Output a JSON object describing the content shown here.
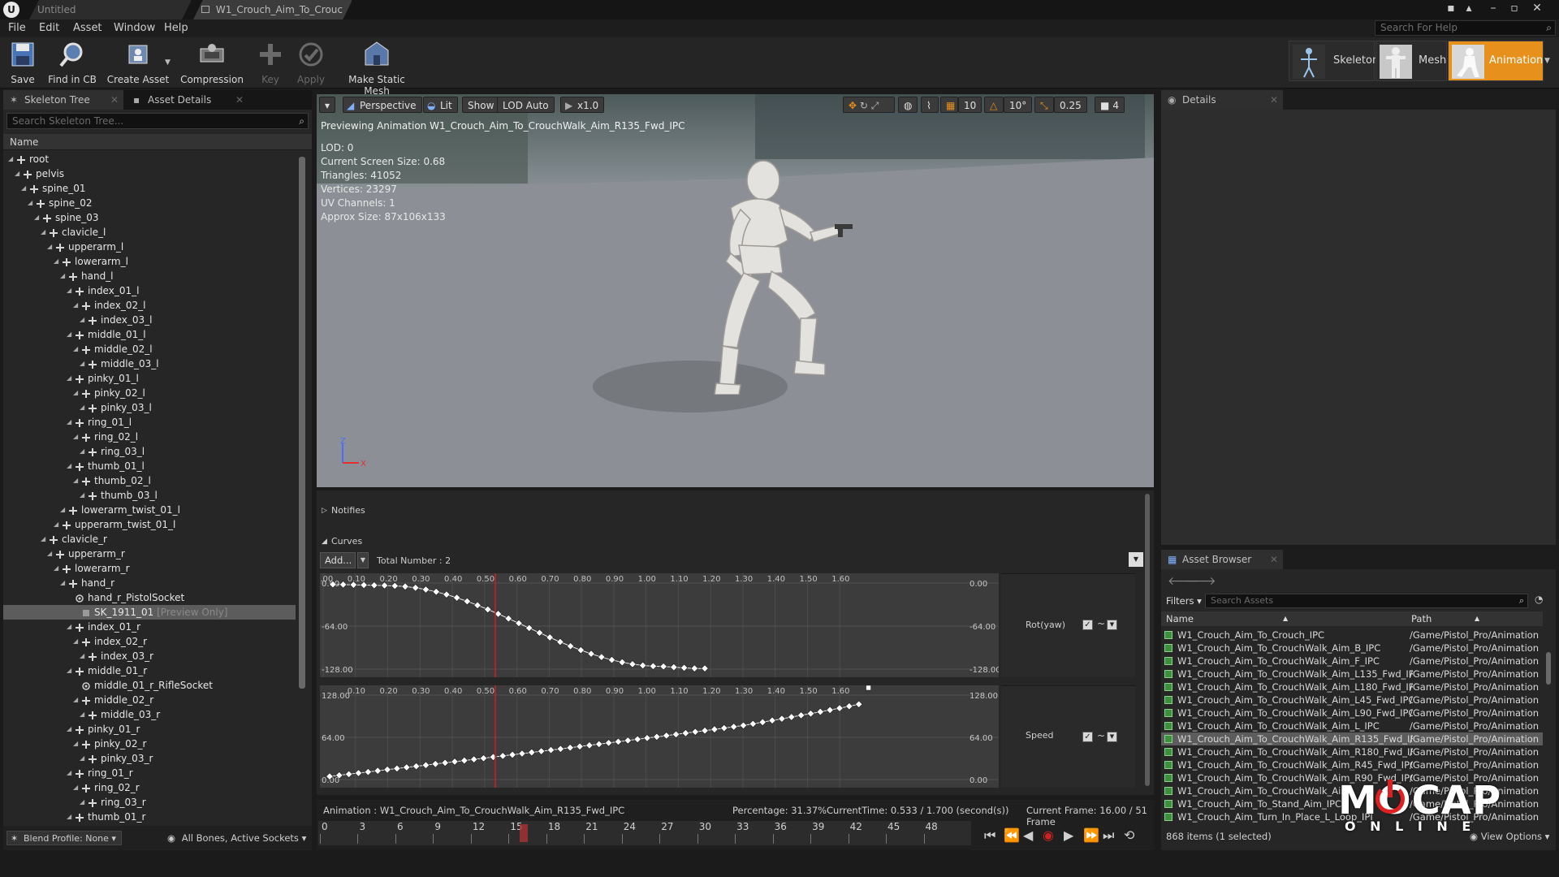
{
  "titlebar": {
    "tabs": [
      {
        "label": "Untitled",
        "active": false
      },
      {
        "label": "W1_Crouch_Aim_To_Crouc",
        "active": true
      }
    ]
  },
  "menubar": {
    "items": [
      "File",
      "Edit",
      "Asset",
      "Window",
      "Help"
    ],
    "search_placeholder": "Search For Help"
  },
  "toolbar": {
    "buttons": [
      {
        "label": "Save",
        "icon": "save-icon",
        "enabled": true
      },
      {
        "label": "Find in CB",
        "icon": "magnifier-icon",
        "enabled": true
      },
      {
        "label": "Create Asset",
        "icon": "create-asset-icon",
        "enabled": true
      },
      {
        "label": "Compression",
        "icon": "compression-icon",
        "enabled": true
      },
      {
        "label": "Key",
        "icon": "plus-icon",
        "enabled": false
      },
      {
        "label": "Apply",
        "icon": "checkmark-icon",
        "enabled": false
      },
      {
        "label": "Make Static Mesh",
        "icon": "static-mesh-icon",
        "enabled": true
      }
    ],
    "modes": [
      {
        "label": "Skeleton",
        "active": false
      },
      {
        "label": "Mesh",
        "active": false
      },
      {
        "label": "Animation",
        "active": true
      }
    ]
  },
  "left_panel": {
    "tabs": [
      {
        "label": "Skeleton Tree",
        "active": true
      },
      {
        "label": "Asset Details",
        "active": false
      }
    ],
    "search_placeholder": "Search Skeleton Tree...",
    "column_header": "Name",
    "tree": [
      {
        "label": "root",
        "depth": 0,
        "kind": "bone"
      },
      {
        "label": "pelvis",
        "depth": 1,
        "kind": "bone"
      },
      {
        "label": "spine_01",
        "depth": 2,
        "kind": "bone"
      },
      {
        "label": "spine_02",
        "depth": 3,
        "kind": "bone"
      },
      {
        "label": "spine_03",
        "depth": 4,
        "kind": "bone"
      },
      {
        "label": "clavicle_l",
        "depth": 5,
        "kind": "bone"
      },
      {
        "label": "upperarm_l",
        "depth": 6,
        "kind": "bone"
      },
      {
        "label": "lowerarm_l",
        "depth": 7,
        "kind": "bone"
      },
      {
        "label": "hand_l",
        "depth": 8,
        "kind": "bone"
      },
      {
        "label": "index_01_l",
        "depth": 9,
        "kind": "bone"
      },
      {
        "label": "index_02_l",
        "depth": 10,
        "kind": "bone"
      },
      {
        "label": "index_03_l",
        "depth": 11,
        "kind": "bone"
      },
      {
        "label": "middle_01_l",
        "depth": 9,
        "kind": "bone"
      },
      {
        "label": "middle_02_l",
        "depth": 10,
        "kind": "bone"
      },
      {
        "label": "middle_03_l",
        "depth": 11,
        "kind": "bone"
      },
      {
        "label": "pinky_01_l",
        "depth": 9,
        "kind": "bone"
      },
      {
        "label": "pinky_02_l",
        "depth": 10,
        "kind": "bone"
      },
      {
        "label": "pinky_03_l",
        "depth": 11,
        "kind": "bone"
      },
      {
        "label": "ring_01_l",
        "depth": 9,
        "kind": "bone"
      },
      {
        "label": "ring_02_l",
        "depth": 10,
        "kind": "bone"
      },
      {
        "label": "ring_03_l",
        "depth": 11,
        "kind": "bone"
      },
      {
        "label": "thumb_01_l",
        "depth": 9,
        "kind": "bone"
      },
      {
        "label": "thumb_02_l",
        "depth": 10,
        "kind": "bone"
      },
      {
        "label": "thumb_03_l",
        "depth": 11,
        "kind": "bone"
      },
      {
        "label": "lowerarm_twist_01_l",
        "depth": 8,
        "kind": "bone"
      },
      {
        "label": "upperarm_twist_01_l",
        "depth": 7,
        "kind": "bone"
      },
      {
        "label": "clavicle_r",
        "depth": 5,
        "kind": "bone"
      },
      {
        "label": "upperarm_r",
        "depth": 6,
        "kind": "bone"
      },
      {
        "label": "lowerarm_r",
        "depth": 7,
        "kind": "bone"
      },
      {
        "label": "hand_r",
        "depth": 8,
        "kind": "bone"
      },
      {
        "label": "hand_r_PistolSocket",
        "depth": 9,
        "kind": "socket"
      },
      {
        "label": "SK_1911_01",
        "depth": 10,
        "kind": "mesh",
        "suffix": "[Preview Only]",
        "selected": true
      },
      {
        "label": "index_01_r",
        "depth": 9,
        "kind": "bone"
      },
      {
        "label": "index_02_r",
        "depth": 10,
        "kind": "bone"
      },
      {
        "label": "index_03_r",
        "depth": 11,
        "kind": "bone"
      },
      {
        "label": "middle_01_r",
        "depth": 9,
        "kind": "bone"
      },
      {
        "label": "middle_01_r_RifleSocket",
        "depth": 10,
        "kind": "socket"
      },
      {
        "label": "middle_02_r",
        "depth": 10,
        "kind": "bone"
      },
      {
        "label": "middle_03_r",
        "depth": 11,
        "kind": "bone"
      },
      {
        "label": "pinky_01_r",
        "depth": 9,
        "kind": "bone"
      },
      {
        "label": "pinky_02_r",
        "depth": 10,
        "kind": "bone"
      },
      {
        "label": "pinky_03_r",
        "depth": 11,
        "kind": "bone"
      },
      {
        "label": "ring_01_r",
        "depth": 9,
        "kind": "bone"
      },
      {
        "label": "ring_02_r",
        "depth": 10,
        "kind": "bone"
      },
      {
        "label": "ring_03_r",
        "depth": 11,
        "kind": "bone"
      },
      {
        "label": "thumb_01_r",
        "depth": 9,
        "kind": "bone"
      }
    ],
    "footer_blend_profile": "Blend Profile: None",
    "footer_filter": "All Bones, Active Sockets"
  },
  "viewport": {
    "menu_button": "▾",
    "perspective": "Perspective",
    "lit": "Lit",
    "show": "Show",
    "lod": "LOD Auto",
    "play_rate": "x1.0",
    "grid_snap": "10",
    "rot_snap": "10°",
    "scale_snap": "0.25",
    "camera_speed": "4",
    "preview_title": "Previewing Animation W1_Crouch_Aim_To_CrouchWalk_Aim_R135_Fwd_IPC",
    "stats": [
      "LOD: 0",
      "Current Screen Size: 0.68",
      "Triangles: 41052",
      "Vertices: 23297",
      "UV Channels: 1",
      "Approx Size: 87x106x133"
    ],
    "axis_labels": {
      "z": "Z",
      "x": "X"
    }
  },
  "anim_panel": {
    "notifies_label": "Notifies",
    "curves_label": "Curves",
    "add_button": "Add...",
    "total_number": "Total Number : 2",
    "curves": [
      {
        "name": "Rot(yaw)",
        "enabled": true,
        "x_ticks": [
          "0.00",
          "0.10",
          "0.20",
          "0.30",
          "0.40",
          "0.50",
          "0.60",
          "0.70",
          "0.80",
          "0.90",
          "1.00",
          "1.10",
          "1.20",
          "1.30",
          "1.40",
          "1.50",
          "1.60"
        ],
        "left_labels": [
          "0.00",
          "-64.00",
          "-128.00"
        ],
        "right_labels": [
          "0.00",
          "-64.00",
          "-128.00"
        ],
        "ylim": [
          -128,
          0
        ]
      },
      {
        "name": "Speed",
        "enabled": true,
        "x_ticks": [
          "0.10",
          "0.20",
          "0.30",
          "0.40",
          "0.50",
          "0.60",
          "0.70",
          "0.80",
          "0.90",
          "1.00",
          "1.10",
          "1.20",
          "1.30",
          "1.40",
          "1.50",
          "1.60"
        ],
        "left_labels": [
          "128.00",
          "64.00",
          "0.00"
        ],
        "right_labels": [
          "128.00",
          "64.00",
          "0.00"
        ],
        "ylim": [
          0,
          140
        ]
      }
    ],
    "playhead_time": 0.533,
    "status": {
      "animation": "Animation :  W1_Crouch_Aim_To_CrouchWalk_Aim_R135_Fwd_IPC",
      "percentage": "Percentage:  31.37%",
      "current_time": "CurrentTime:  0.533 / 1.700 (second(s))",
      "current_frame": "Current Frame:  16.00 / 51 Frame"
    },
    "frame_ticks": [
      "0",
      "3",
      "6",
      "9",
      "12",
      "15",
      "18",
      "21",
      "24",
      "27",
      "30",
      "33",
      "36",
      "39",
      "42",
      "45",
      "48"
    ],
    "current_frame_value": 16,
    "total_frames": 51
  },
  "details": {
    "tab": "Details"
  },
  "asset_browser": {
    "tab": "Asset Browser",
    "filters": "Filters",
    "search_placeholder": "Search Assets",
    "col_name": "Name",
    "col_path": "Path",
    "rows": [
      {
        "name": "W1_Crouch_Aim_To_Crouch_IPC",
        "path": "/Game/Pistol_Pro/Animation"
      },
      {
        "name": "W1_Crouch_Aim_To_CrouchWalk_Aim_B_IPC",
        "path": "/Game/Pistol_Pro/Animation"
      },
      {
        "name": "W1_Crouch_Aim_To_CrouchWalk_Aim_F_IPC",
        "path": "/Game/Pistol_Pro/Animation"
      },
      {
        "name": "W1_Crouch_Aim_To_CrouchWalk_Aim_L135_Fwd_IP",
        "path": "/Game/Pistol_Pro/Animation"
      },
      {
        "name": "W1_Crouch_Aim_To_CrouchWalk_Aim_L180_Fwd_IP",
        "path": "/Game/Pistol_Pro/Animation"
      },
      {
        "name": "W1_Crouch_Aim_To_CrouchWalk_Aim_L45_Fwd_IPC",
        "path": "/Game/Pistol_Pro/Animation"
      },
      {
        "name": "W1_Crouch_Aim_To_CrouchWalk_Aim_L90_Fwd_IPC",
        "path": "/Game/Pistol_Pro/Animation"
      },
      {
        "name": "W1_Crouch_Aim_To_CrouchWalk_Aim_L_IPC",
        "path": "/Game/Pistol_Pro/Animation"
      },
      {
        "name": "W1_Crouch_Aim_To_CrouchWalk_Aim_R135_Fwd_IF",
        "path": "/Game/Pistol_Pro/Animation",
        "selected": true
      },
      {
        "name": "W1_Crouch_Aim_To_CrouchWalk_Aim_R180_Fwd_IF",
        "path": "/Game/Pistol_Pro/Animation"
      },
      {
        "name": "W1_Crouch_Aim_To_CrouchWalk_Aim_R45_Fwd_IPC",
        "path": "/Game/Pistol_Pro/Animation"
      },
      {
        "name": "W1_Crouch_Aim_To_CrouchWalk_Aim_R90_Fwd_IPC",
        "path": "/Game/Pistol_Pro/Animation"
      },
      {
        "name": "W1_Crouch_Aim_To_CrouchWalk_Aim",
        "path": "/Game/Pistol_Pro/Animation"
      },
      {
        "name": "W1_Crouch_Aim_To_Stand_Aim_IPC",
        "path": "/Game/Pistol_Pro/Animation"
      },
      {
        "name": "W1_Crouch_Aim_Turn_In_Place_L_Loop_IPI",
        "path": "/Game/Pistol_Pro/Animation"
      }
    ],
    "count": "868 items (1 selected)",
    "view_options": "View Options"
  },
  "watermark": {
    "line1": "MOCAP",
    "line2": "O N L I N E"
  },
  "colors": {
    "accent": "#e8901c",
    "playhead": "#d02020",
    "viewport_floor": "#8c8f95"
  }
}
